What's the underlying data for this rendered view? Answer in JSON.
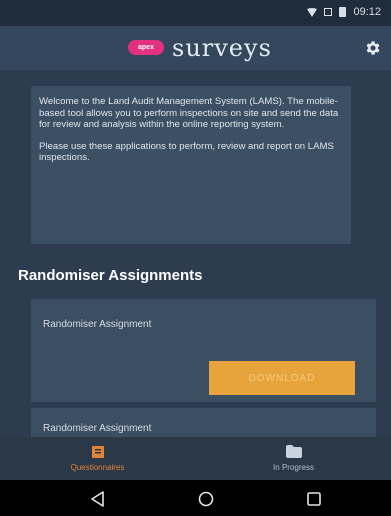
{
  "status_bar": {
    "time": "09:12"
  },
  "app_bar": {
    "logo_text": "apex",
    "title": "surveys",
    "settings_icon": "gear-icon"
  },
  "welcome": {
    "paragraph1": "Welcome to the Land Audit Management System (LAMS). The mobile-based tool allows you to perform inspections on site and send the data for review and analysis within the online reporting system.",
    "paragraph2": "Please use these applications to perform, review and report on LAMS inspections."
  },
  "randomiser": {
    "heading": "Randomiser Assignments",
    "items": [
      {
        "title": "Randomiser Assignment",
        "button_label": "DOWNLOAD"
      },
      {
        "title": "Randomiser Assignment"
      }
    ]
  },
  "bottom_nav": {
    "tabs": [
      {
        "label": "Questionnaires",
        "icon": "questionnaire-icon",
        "active": true
      },
      {
        "label": "In Progress",
        "icon": "folder-icon",
        "active": false
      }
    ]
  },
  "colors": {
    "accent": "#e8a43c",
    "brand_pink": "#e2317f",
    "background": "#2d3c4e"
  }
}
